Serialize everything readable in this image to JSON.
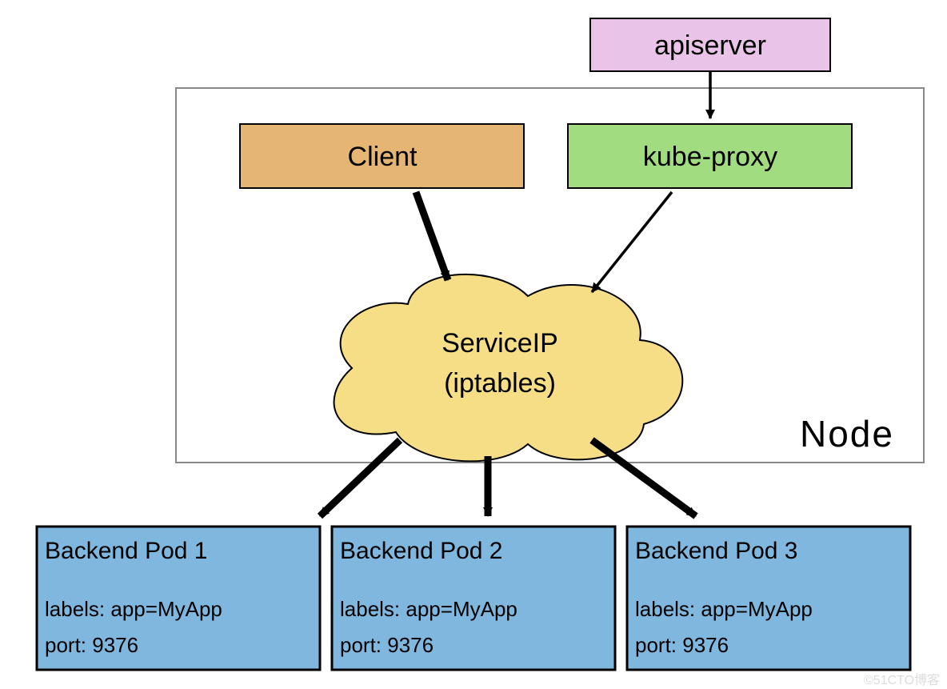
{
  "apiserver": {
    "label": "apiserver"
  },
  "client": {
    "label": "Client"
  },
  "kubeproxy": {
    "label": "kube-proxy"
  },
  "service": {
    "line1": "ServiceIP",
    "line2": "(iptables)"
  },
  "node": {
    "label": "Node"
  },
  "pods": [
    {
      "title": "Backend Pod 1",
      "labels": "labels: app=MyApp",
      "port": "port: 9376"
    },
    {
      "title": "Backend Pod 2",
      "labels": "labels: app=MyApp",
      "port": "port: 9376"
    },
    {
      "title": "Backend Pod 3",
      "labels": "labels: app=MyApp",
      "port": "port: 9376"
    }
  ],
  "watermark": "©51CTO博客"
}
